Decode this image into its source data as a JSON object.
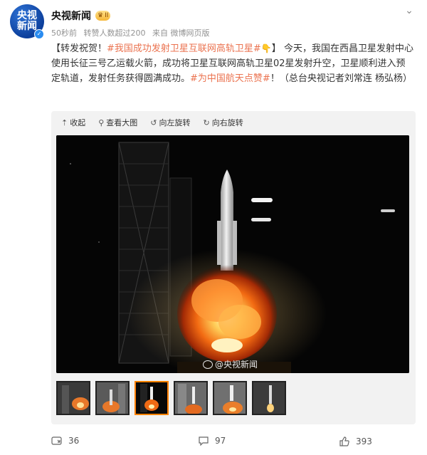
{
  "author": {
    "avatar_line1": "央视",
    "avatar_line2": "新闻",
    "name": "央视新闻",
    "badge_level": "II"
  },
  "meta": {
    "time": "50秒前",
    "reposts": "转赞人数超过200",
    "source": "来自 微博网页版"
  },
  "post": {
    "open_bracket": "【",
    "lead": "转发祝贺！",
    "topic1": "#我国成功发射卫星互联网高轨卫星#",
    "close_bracket": "】",
    "body": "今天，我国在西昌卫星发射中心使用长征三号乙运载火箭，成功将卫星互联网高轨卫星02星发射升空，卫星顺利进入预定轨道，发射任务获得圆满成功。",
    "topic2": "#为中国航天点赞#",
    "tail": "！（总台央视记者刘常连 杨弘杨）"
  },
  "media_toolbar": {
    "collapse": "收起",
    "view_large": "查看大图",
    "rotate_left": "向左旋转",
    "rotate_right": "向右旋转"
  },
  "image": {
    "watermark": "@央视新闻"
  },
  "actions": {
    "reposts": "36",
    "comments": "97",
    "likes": "393"
  },
  "colors": {
    "topic": "#eb7350",
    "thumb_active": "#ff8200"
  },
  "icons": [
    "more-icon",
    "collapse-icon",
    "magnifier-icon",
    "rotate-left-icon",
    "rotate-right-icon",
    "repost-icon",
    "comment-icon",
    "like-icon",
    "verified-icon"
  ]
}
